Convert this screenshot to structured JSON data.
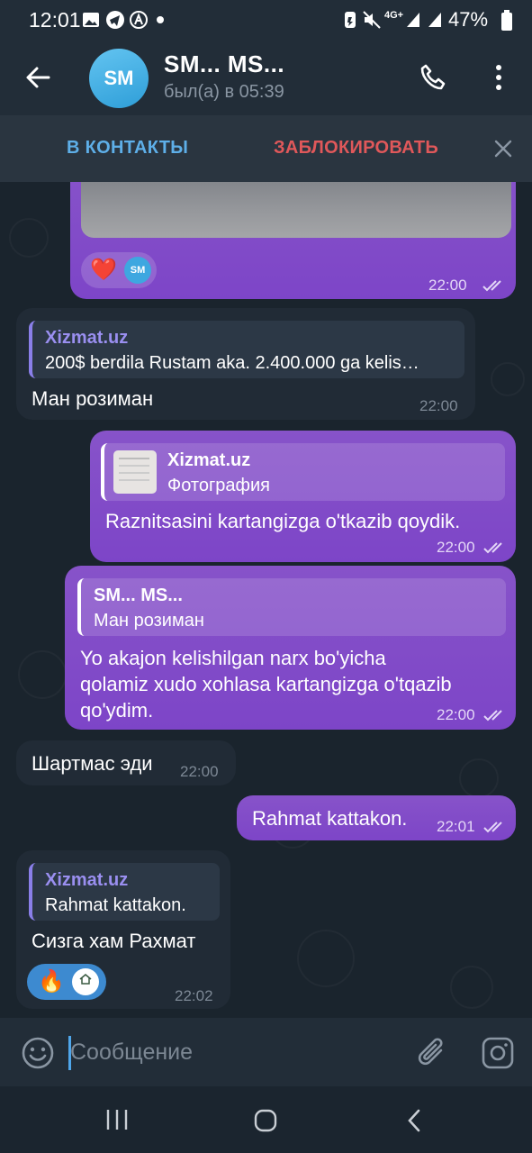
{
  "status_bar": {
    "time": "12:01",
    "network": "4G+",
    "battery": "47%"
  },
  "header": {
    "avatar_initials": "SM",
    "title": "SM... MS...",
    "subtitle": "был(а) в 05:39"
  },
  "action_bar": {
    "add_contact": "В КОНТАКТЫ",
    "block": "ЗАБЛОКИРОВАТЬ"
  },
  "messages": [
    {
      "time": "22:00",
      "reaction": "❤️",
      "reactor": "SM"
    },
    {
      "reply_name": "Xizmat.uz",
      "reply_text": "200$ berdila Rustam aka.  2.400.000 ga kelis…",
      "text": "Ман розиман",
      "time": "22:00"
    },
    {
      "reply_name": "Xizmat.uz",
      "reply_text": "Фотография",
      "text": "Raznitsasini kartangizga o'tkazib qoydik.",
      "time": "22:00"
    },
    {
      "reply_name": "SM... MS...",
      "reply_text": "Ман розиман",
      "text_lines": [
        "Yo akajon kelishilgan narx bo'yicha",
        "qolamiz xudo xohlasa kartangizga o'tqazib",
        "qo'ydim."
      ],
      "time": "22:00"
    },
    {
      "text": "Шартмас эди",
      "time": "22:00"
    },
    {
      "text": "Rahmat kattakon.",
      "time": "22:01"
    },
    {
      "reply_name": "Xizmat.uz",
      "reply_text": "Rahmat kattakon.",
      "text": "Сизга хам Рахмат",
      "time": "22:02",
      "reaction": "🔥"
    }
  ],
  "input": {
    "placeholder": "Сообщение"
  },
  "colors": {
    "outgoing": "#7d45c8",
    "incoming": "#212b36",
    "accent": "#5eafe8",
    "danger": "#e0585a"
  }
}
